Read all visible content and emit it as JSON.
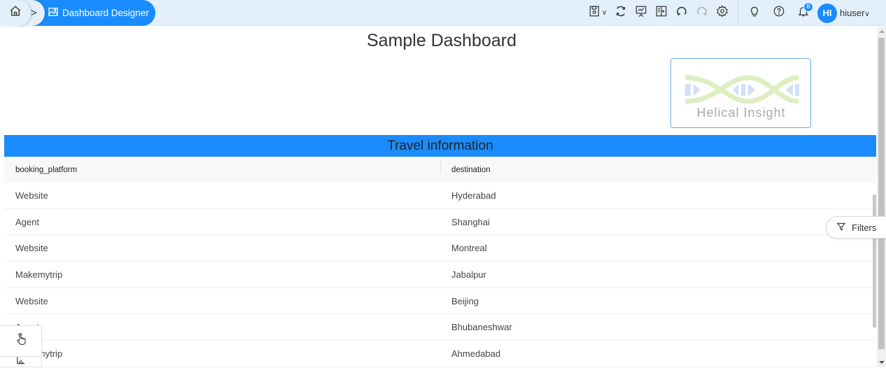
{
  "breadcrumb": {
    "home_icon": "home-icon",
    "separator": ">",
    "active_icon": "image-icon",
    "active_label": "Dashboard Designer"
  },
  "toolbar": {
    "icons": [
      "save-icon",
      "chevron-down-icon",
      "refresh-icon",
      "presentation-icon",
      "panel-toggle-icon",
      "undo-icon",
      "redo-icon",
      "settings-icon",
      "lightbulb-icon",
      "help-icon",
      "bell-icon"
    ],
    "notification_count": "8",
    "avatar_initials": "HI",
    "username": "hiuser",
    "user_caret": "⌄"
  },
  "dashboard": {
    "title": "Sample Dashboard",
    "logo_text": "Helical Insight",
    "brand_color": "#1a8cff"
  },
  "report": {
    "title": "Travel information",
    "columns": [
      "booking_platform",
      "destination"
    ],
    "rows": [
      [
        "Website",
        "Hyderabad"
      ],
      [
        "Agent",
        "Shanghai"
      ],
      [
        "Website",
        "Montreal"
      ],
      [
        "Makemytrip",
        "Jabalpur"
      ],
      [
        "Website",
        "Beijing"
      ],
      [
        "Agent",
        "Bhubaneshwar"
      ],
      [
        "Makemytrip",
        "Ahmedabad"
      ]
    ]
  },
  "filters": {
    "label": "Filters",
    "icon": "filter-icon"
  },
  "float_panel": {
    "icons": [
      "hand-pointer-icon",
      "bar-chart-icon"
    ]
  }
}
